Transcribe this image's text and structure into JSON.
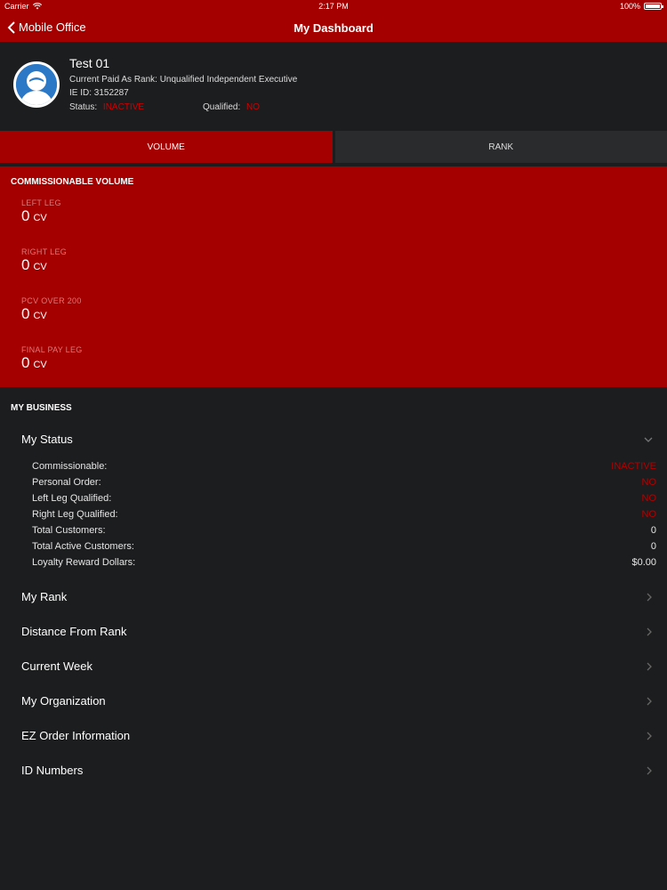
{
  "statusbar": {
    "carrier": "Carrier",
    "time": "2:17 PM",
    "battery": "100%"
  },
  "navbar": {
    "back_label": "Mobile Office",
    "title": "My Dashboard"
  },
  "profile": {
    "name": "Test 01",
    "rank_line": "Current Paid As Rank: Unqualified Independent Executive",
    "ieid_line": "IE ID: 3152287",
    "status_label": "Status:",
    "status_value": "INACTIVE",
    "qualified_label": "Qualified:",
    "qualified_value": "NO"
  },
  "tabs": [
    {
      "label": "VOLUME",
      "active": true
    },
    {
      "label": "RANK",
      "active": false
    }
  ],
  "commissionable_volume": {
    "heading": "COMMISSIONABLE VOLUME",
    "items": [
      {
        "label": "LEFT LEG",
        "value": "0",
        "unit": "CV"
      },
      {
        "label": "RIGHT LEG",
        "value": "0",
        "unit": "CV"
      },
      {
        "label": "PCV OVER 200",
        "value": "0",
        "unit": "CV"
      },
      {
        "label": "FINAL PAY LEG",
        "value": "0",
        "unit": "CV"
      }
    ]
  },
  "my_business": {
    "heading": "MY BUSINESS",
    "status_section": {
      "label": "My Status",
      "rows": [
        {
          "key": "Commissionable:",
          "value": "INACTIVE",
          "red": true
        },
        {
          "key": "Personal Order:",
          "value": "NO",
          "red": true
        },
        {
          "key": "Left Leg Qualified:",
          "value": "NO",
          "red": true
        },
        {
          "key": "Right Leg Qualified:",
          "value": "NO",
          "red": true
        },
        {
          "key": "Total Customers:",
          "value": "0",
          "red": false
        },
        {
          "key": "Total Active Customers:",
          "value": "0",
          "red": false
        },
        {
          "key": "Loyalty Reward Dollars:",
          "value": "$0.00",
          "red": false
        }
      ]
    },
    "sections": [
      {
        "label": "My Rank"
      },
      {
        "label": "Distance From Rank"
      },
      {
        "label": "Current Week"
      },
      {
        "label": "My Organization"
      },
      {
        "label": "EZ Order Information"
      },
      {
        "label": "ID Numbers"
      }
    ]
  },
  "colors": {
    "brand_red": "#a50000",
    "background": "#1c1d1f",
    "accent_red_text": "#b40000"
  },
  "icons": [
    "back-chevron-icon",
    "wifi-icon",
    "battery-icon",
    "avatar-icon",
    "chevron-down-icon",
    "chevron-right-icon"
  ]
}
